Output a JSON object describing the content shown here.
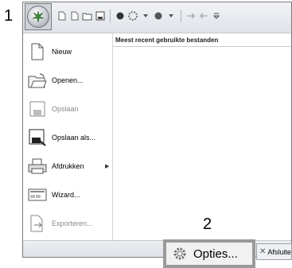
{
  "callouts": {
    "step1": "1",
    "step2": "2"
  },
  "menu": {
    "items": [
      {
        "label": "Nieuw",
        "icon": "new-document-icon",
        "enabled": true
      },
      {
        "label": "Openen...",
        "icon": "open-folder-icon",
        "enabled": true
      },
      {
        "label": "Opslaan",
        "icon": "save-icon",
        "enabled": false
      },
      {
        "label": "Opslaan als...",
        "icon": "save-as-icon",
        "enabled": true
      },
      {
        "label": "Afdrukken",
        "icon": "print-icon",
        "enabled": true,
        "has_submenu": true
      },
      {
        "label": "Wizard...",
        "icon": "wizard-icon",
        "enabled": true
      },
      {
        "label": "Exporteren...",
        "icon": "export-icon",
        "enabled": false
      }
    ],
    "recent_header": "Meest recent gebruikte bestanden",
    "options_label": "Opties...",
    "exit_label": "Afsluite"
  },
  "colors": {
    "accent": "#2a6fb0",
    "highlight_border": "#9a9a9a"
  }
}
